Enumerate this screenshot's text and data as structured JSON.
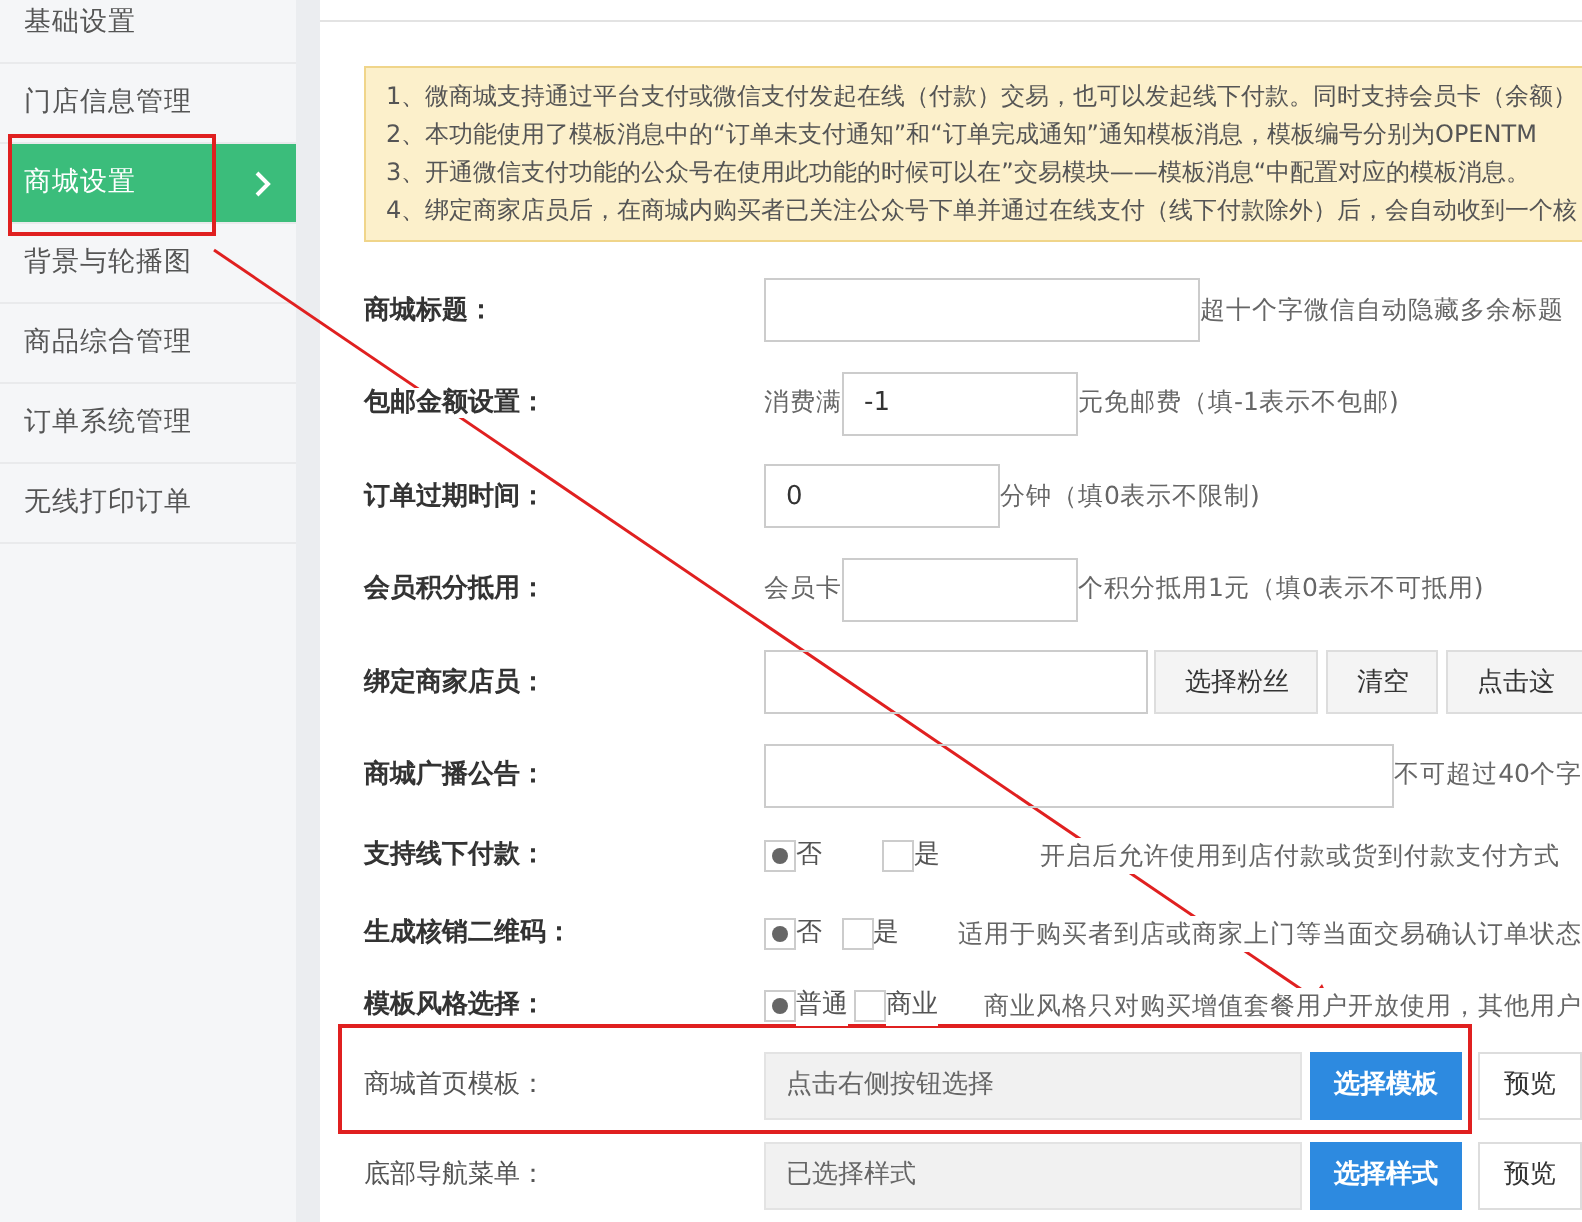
{
  "sidebar": {
    "items": [
      {
        "label": "基础设置",
        "selected": false
      },
      {
        "label": "门店信息管理",
        "selected": false
      },
      {
        "label": "商城设置",
        "selected": true
      },
      {
        "label": "背景与轮播图",
        "selected": false
      },
      {
        "label": "商品综合管理",
        "selected": false
      },
      {
        "label": "订单系统管理",
        "selected": false
      },
      {
        "label": "无线打印订单",
        "selected": false
      }
    ]
  },
  "notice": [
    "1、微商城支持通过平台支付或微信支付发起在线（付款）交易，也可以发起线下付款。同时支持会员卡（余额）",
    "2、本功能使用了模板消息中的“订单未支付通知”和“订单完成通知”通知模板消息，模板编号分别为OPENTM",
    "3、开通微信支付功能的公众号在使用此功能的时候可以在”交易模块——模板消息“中配置对应的模板消息。",
    "4、绑定商家店员后，在商城内购买者已关注公众号下单并通过在线支付（线下付款除外）后，会自动收到一个核"
  ],
  "form": [
    {
      "kind": "text",
      "label": "商城标题：",
      "suffix": "超十个字微信自动隐藏多余标题"
    },
    {
      "kind": "number",
      "label": "包邮金额设置：",
      "prefix": "消费满",
      "value": "-1",
      "suffix": "元免邮费（填-1表示不包邮)"
    },
    {
      "kind": "number",
      "label": "订单过期时间：",
      "value": "0",
      "suffix": "分钟（填0表示不限制)"
    },
    {
      "kind": "number",
      "label": "会员积分抵用：",
      "prefix": "会员卡",
      "suffix": "个积分抵用1元（填0表示不可抵用)"
    },
    {
      "kind": "buttons",
      "label": "绑定商家店员：",
      "buttons": [
        "选择粉丝",
        "清空",
        "点击这"
      ]
    },
    {
      "kind": "longtext",
      "label": "商城广播公告：",
      "suffix": "不可超过40个字"
    },
    {
      "kind": "radio",
      "label": "支持线下付款：",
      "options": [
        {
          "label": "否",
          "selected": true
        },
        {
          "label": "是",
          "selected": false
        }
      ],
      "note": "开启后允许使用到店付款或货到付款支付方式"
    },
    {
      "kind": "radio",
      "label": "生成核销二维码：",
      "options": [
        {
          "label": "否",
          "selected": true
        },
        {
          "label": "是",
          "selected": false
        }
      ],
      "note": "适用于购买者到店或商家上门等当面交易确认订单状态"
    },
    {
      "kind": "radio",
      "label": "模板风格选择：",
      "options": [
        {
          "label": "普通",
          "selected": true
        },
        {
          "label": "商业",
          "selected": false
        }
      ],
      "note": "商业风格只对购买增值套餐用户开放使用，其他用户"
    },
    {
      "kind": "picker",
      "label": "商城首页模板：",
      "value": "点击右侧按钮选择",
      "action": "选择模板",
      "preview": "预览"
    },
    {
      "kind": "picker",
      "label": "底部导航菜单：",
      "value": "已选择样式",
      "action": "选择样式",
      "preview": "预览"
    }
  ]
}
